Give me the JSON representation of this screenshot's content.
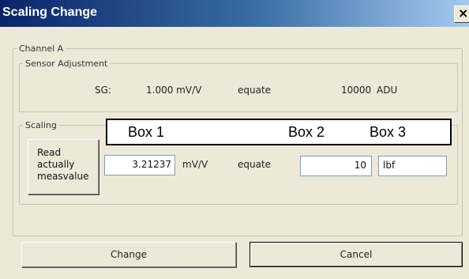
{
  "window": {
    "title": "Scaling Change",
    "close_glyph": "×"
  },
  "channel": {
    "legend": "Channel A"
  },
  "sensor": {
    "legend": "Sensor Adjustment",
    "sg_label": "SG:",
    "sg_value": "1.000 mV/V",
    "equate": "equate",
    "adu_value": "10000",
    "adu_unit": "ADU"
  },
  "scaling": {
    "legend": "Scaling",
    "read_button": "Read\nactually\nmeasvalue",
    "value_1": "3.21237",
    "unit_1": "mV/V",
    "equate": "equate",
    "value_2": "10",
    "unit_2": "lbf"
  },
  "overlay": {
    "box1": "Box 1",
    "box2": "Box 2",
    "box3": "Box 3"
  },
  "buttons": {
    "change": "Change",
    "cancel": "Cancel"
  },
  "colors": {
    "title_bar_start": "#0a246a",
    "title_bar_end": "#a6caf0",
    "dialog_bg": "#ece9d8",
    "input_border": "#7f9db9"
  },
  "icons": {
    "close": "close-icon"
  }
}
